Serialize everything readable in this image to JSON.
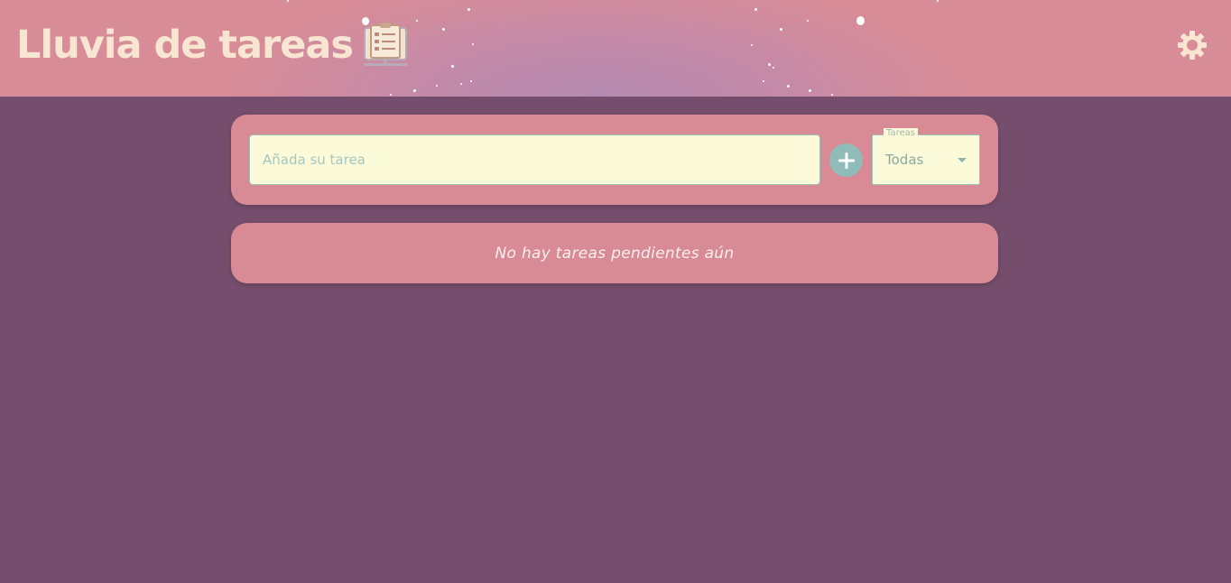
{
  "header": {
    "title": "Lluvia de tareas",
    "logo_icon": "clipboard-list-icon",
    "settings_icon": "gear-icon"
  },
  "form": {
    "task_placeholder": "Añada su tarea",
    "task_value": "",
    "add_icon": "plus-icon",
    "filter_legend": "Tareas",
    "filter_selected": "Todas"
  },
  "list": {
    "empty_message": "No hay tareas pendientes aún"
  },
  "colors": {
    "background": "#764e6d",
    "header": "#d88c97",
    "card": "#d88b95",
    "input_bg": "#fbfbd9",
    "accent": "#8fbcb8",
    "title": "#f8e6d2"
  }
}
